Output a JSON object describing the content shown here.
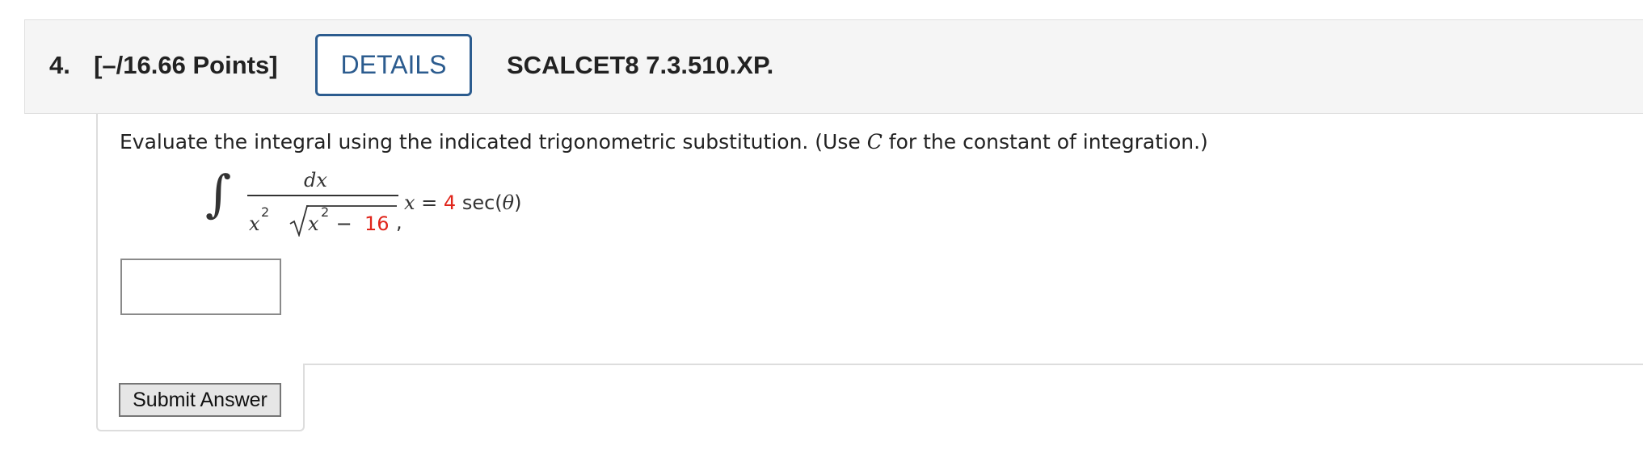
{
  "question": {
    "number_label": "4.",
    "points_label": "[–/16.66 Points]",
    "details_label": "DETAILS",
    "code": "SCALCET8 7.3.510.XP."
  },
  "problem": {
    "prompt_before": "Evaluate the integral using the indicated trigonometric substitution. (Use ",
    "prompt_var": "C",
    "prompt_after": " for the constant of integration.)",
    "integral_sign": "∫",
    "numerator": "dx",
    "den_x": "x",
    "den_exp": "2",
    "den_inner_x": "x",
    "den_inner_exp": "2",
    "den_minus": " − ",
    "den_const": "16",
    "comma": ",",
    "subst_var": "x",
    "subst_eq": " = ",
    "subst_coef": "4",
    "subst_func": " sec(",
    "subst_theta": "θ",
    "subst_close": ")",
    "highlight_color": "#e0251b"
  },
  "answer": {
    "value": ""
  },
  "actions": {
    "submit_label": "Submit Answer"
  }
}
